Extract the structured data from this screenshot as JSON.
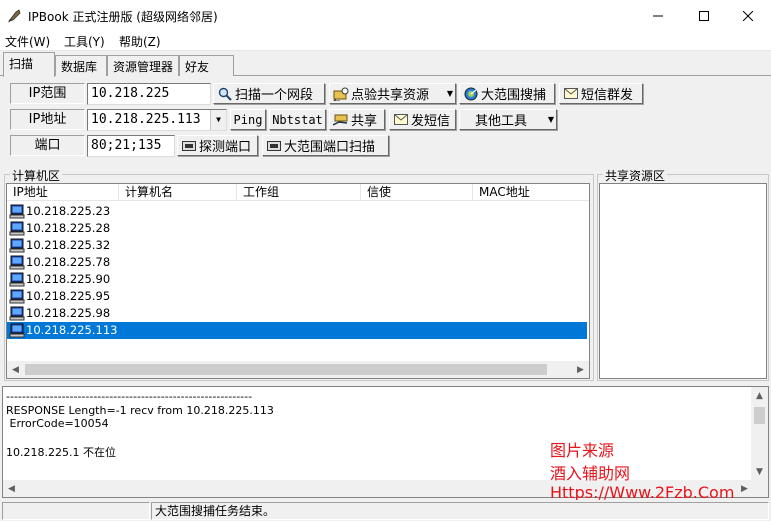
{
  "window": {
    "title": "IPBook 正式注册版 (超级网络邻居)"
  },
  "menu": {
    "file": "文件(W)",
    "tools": "工具(Y)",
    "help": "帮助(Z)"
  },
  "tabs": [
    "扫描",
    "数据库",
    "资源管理器",
    "好友"
  ],
  "toolbar": {
    "ip_range_label": "IP范围",
    "ip_range_value": "10.218.225",
    "scan_segment": "扫描一个网段",
    "check_shares": "点验共享资源",
    "wide_search": "大范围搜捕",
    "sms_mass": "短信群发",
    "ip_addr_label": "IP地址",
    "ip_addr_value": "10.218.225.113",
    "ping": "Ping",
    "nbtstat": "Nbtstat",
    "share": "共享",
    "send_sms": "发短信",
    "other_tools": "其他工具",
    "port_label": "端口",
    "port_value": "80;21;135",
    "probe_port": "探测端口",
    "wide_port_scan": "大范围端口扫描"
  },
  "computers": {
    "group_label": "计算机区",
    "columns": [
      "IP地址",
      "计算机名",
      "工作组",
      "信使",
      "MAC地址"
    ],
    "rows": [
      {
        "ip": "10.218.225.23",
        "selected": false
      },
      {
        "ip": "10.218.225.28",
        "selected": false
      },
      {
        "ip": "10.218.225.32",
        "selected": false
      },
      {
        "ip": "10.218.225.78",
        "selected": false
      },
      {
        "ip": "10.218.225.90",
        "selected": false
      },
      {
        "ip": "10.218.225.95",
        "selected": false
      },
      {
        "ip": "10.218.225.98",
        "selected": false
      },
      {
        "ip": "10.218.225.113",
        "selected": true
      }
    ]
  },
  "shares": {
    "group_label": "共享资源区"
  },
  "log": {
    "lines": [
      "--------------------------------------------------------------",
      "RESPONSE Length=-1 recv from 10.218.225.113",
      " ErrorCode=10054",
      "",
      "10.218.225.1 不在位"
    ]
  },
  "watermark": {
    "line1": "图片来源",
    "line2": "酒入辅助网",
    "line3": "Https://Www.2Fzb.Com"
  },
  "status": {
    "panel1": "",
    "panel2": "大范围搜捕任务结束。"
  },
  "colors": {
    "selection": "#0078d7",
    "watermark": "#e8141c"
  }
}
